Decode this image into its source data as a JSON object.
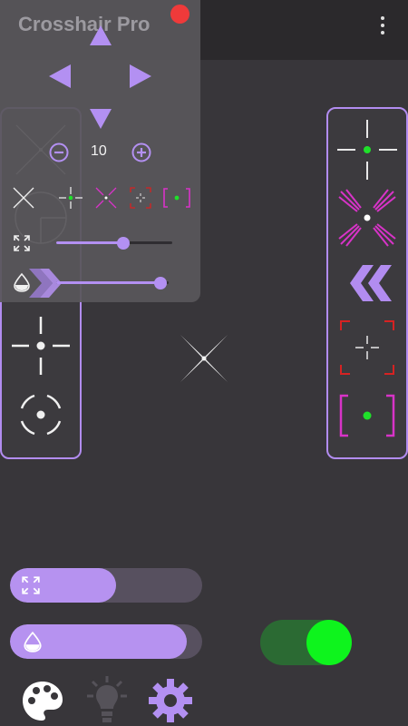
{
  "app": {
    "title": "Crosshair Pro"
  },
  "overlay": {
    "size_value": "10"
  },
  "size_slider": {
    "level": 0.58
  },
  "opacity_slider": {
    "level": 0.93
  },
  "bottom_size_bar": {
    "level": 0.55
  },
  "bottom_opacity_bar": {
    "level": 0.92
  },
  "toggle": {
    "state": "on"
  },
  "colors": {
    "accent": "#b390f2",
    "toggle_on": "#0ef41d",
    "close": "#ef3a3a"
  },
  "icons": [
    "menu-icon",
    "close-icon",
    "up-arrow-icon",
    "left-arrow-icon",
    "right-arrow-icon",
    "down-arrow-icon",
    "minus-icon",
    "plus-icon",
    "expand-icon",
    "opacity-drop-icon",
    "double-chevron-left-icon",
    "palette-icon",
    "lightbulb-icon",
    "gear-icon"
  ]
}
